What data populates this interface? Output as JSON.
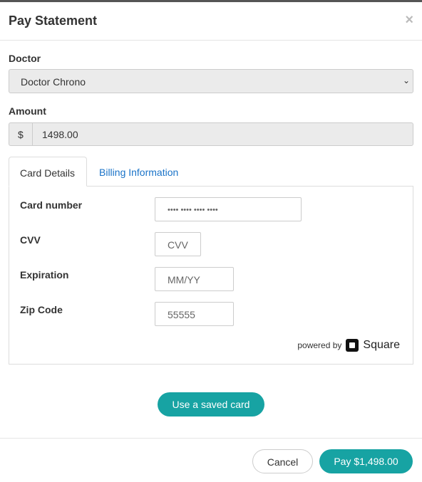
{
  "modal": {
    "title": "Pay Statement",
    "close": "×"
  },
  "doctor": {
    "label": "Doctor",
    "value": "Doctor Chrono"
  },
  "amount": {
    "label": "Amount",
    "prefix": "$",
    "value": "1498.00"
  },
  "tabs": [
    {
      "label": "Card Details",
      "active": true
    },
    {
      "label": "Billing Information",
      "active": false
    }
  ],
  "card": {
    "number_label": "Card number",
    "number_placeholder": "•••• •••• •••• ••••",
    "cvv_label": "CVV",
    "cvv_placeholder": "CVV",
    "exp_label": "Expiration",
    "exp_placeholder": "MM/YY",
    "zip_label": "Zip Code",
    "zip_value": "55555"
  },
  "powered": {
    "text": "powered by",
    "brand": "Square"
  },
  "saved_card": "Use a saved card",
  "footer": {
    "cancel": "Cancel",
    "pay": "Pay $1,498.00"
  },
  "colors": {
    "accent": "#17a3a3",
    "link": "#1a73c8"
  }
}
